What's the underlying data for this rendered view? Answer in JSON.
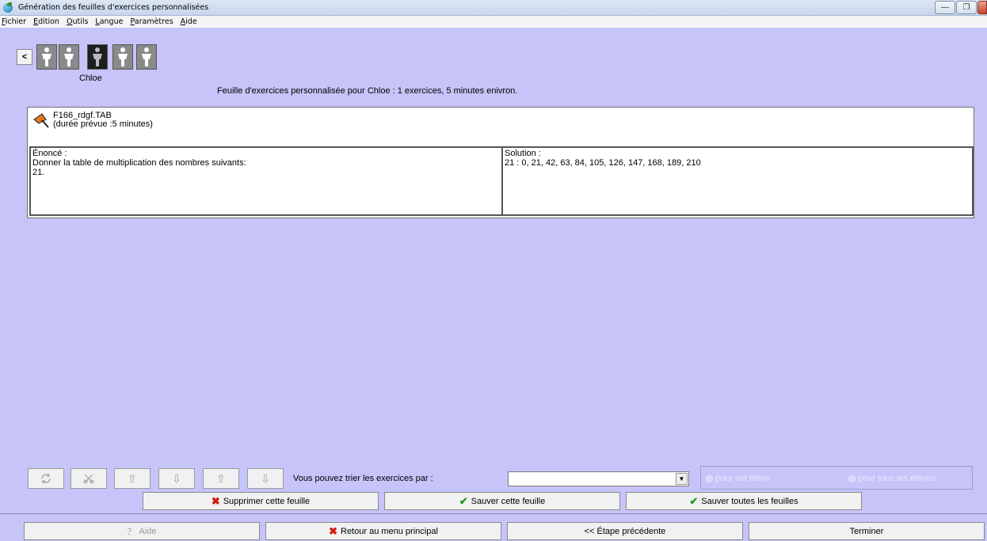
{
  "window": {
    "title": "Génération des feuilles d'exercices personnalisées",
    "buttons": [
      "minimize",
      "restore",
      "close"
    ]
  },
  "menu": [
    {
      "underline": "F",
      "rest": "ichier"
    },
    {
      "underline": "E",
      "rest": "dition"
    },
    {
      "underline": "O",
      "rest": "utils"
    },
    {
      "underline": "L",
      "rest": "angue"
    },
    {
      "underline": "P",
      "rest": "aramètres"
    },
    {
      "underline": "A",
      "rest": "ide"
    }
  ],
  "students": {
    "prev_label": "<",
    "count": 5,
    "active_index": 2,
    "active_name": "Chloe"
  },
  "sheet_info": "Feuille d'exercices personnalisée pour Chloe  : 1 exercices, 5 minutes enivron.",
  "exercise": {
    "file": "F166_rdgf.TAB",
    "duration": "(durée prévue :5 minutes)",
    "enonce_label": "Énoncé :",
    "enonce_line1": "Donner la table de multiplication des nombres suivants:",
    "enonce_line2": "21.",
    "solution_label": "Solution :",
    "solution_line1": "21 :  0, 21, 42, 63, 84, 105, 126, 147, 168, 189, 210"
  },
  "sort": {
    "label": "Vous pouvez trier les exercices par :",
    "selected": "",
    "radio_this_student": "pour cet élève",
    "radio_all_students": "pour tous les élèves"
  },
  "sheet_buttons": {
    "delete": "Supprimer cette feuille",
    "save": "Sauver cette feuille",
    "save_all": "Sauver toutes les feuilles"
  },
  "footer": {
    "help": "Aide",
    "back_menu": "Retour au menu principal",
    "previous_step": "<< Étape précédente",
    "finish": "Terminer"
  }
}
